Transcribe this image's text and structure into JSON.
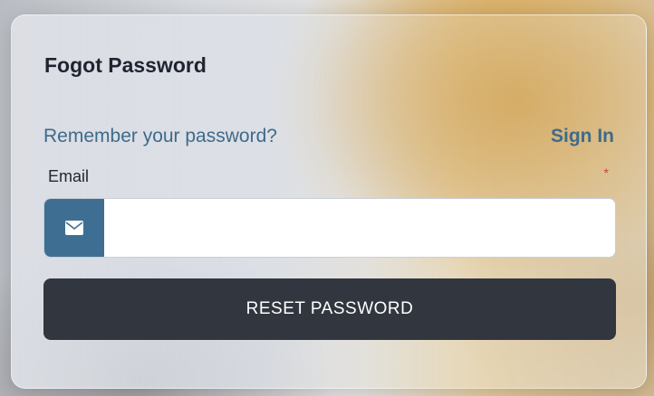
{
  "form": {
    "title": "Fogot Password",
    "remember_text": "Remember your password?",
    "signin_label": "Sign In",
    "email_label": "Email",
    "required_marker": "*",
    "email_value": "",
    "email_icon": "envelope-icon",
    "reset_label": "RESET PASSWORD"
  },
  "colors": {
    "accent": "#3e6f93",
    "link": "#3d6b8c",
    "button_bg": "#31363f",
    "required": "#d23b3b"
  }
}
